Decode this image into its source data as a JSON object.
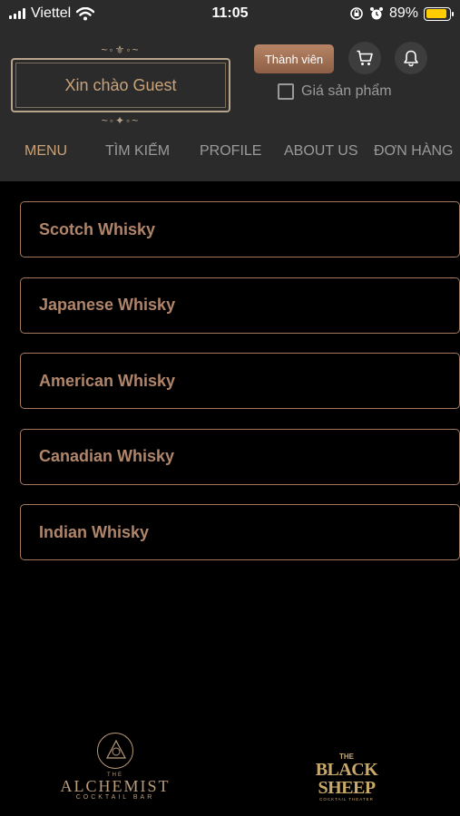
{
  "status_bar": {
    "carrier": "Viettel",
    "time": "11:05",
    "battery": "89%",
    "battery_level": 0.89,
    "icons": [
      "signal-icon",
      "wifi-icon",
      "rotation-lock-icon",
      "alarm-icon",
      "battery-icon"
    ]
  },
  "header": {
    "greeting": "Xin chào Guest",
    "member_button": "Thành viên",
    "price_checkbox_label": "Giá sản phẩm",
    "price_checked": false,
    "icons": [
      "cart-icon",
      "bell-icon"
    ]
  },
  "nav": {
    "items": [
      "MENU",
      "TÌM KIẾM",
      "PROFILE",
      "ABOUT US",
      "ĐƠN HÀNG"
    ],
    "active": "MENU"
  },
  "menu": {
    "items": [
      "Scotch Whisky",
      "Japanese Whisky",
      "American Whisky",
      "Canadian Whisky",
      "Indian Whisky"
    ]
  },
  "footer": {
    "alchemist": {
      "small": "THE",
      "name": "ALCHEMIST",
      "sub": "COCKTAIL BAR"
    },
    "blacksheep": {
      "small": "THE",
      "name": "BLACK SHEEP",
      "sub": "COCKTAIL THEATER"
    }
  },
  "colors": {
    "accent": "#c9a27a",
    "border": "#a6785d",
    "header_bg": "#2b2b2b",
    "page_bg": "#000000"
  }
}
